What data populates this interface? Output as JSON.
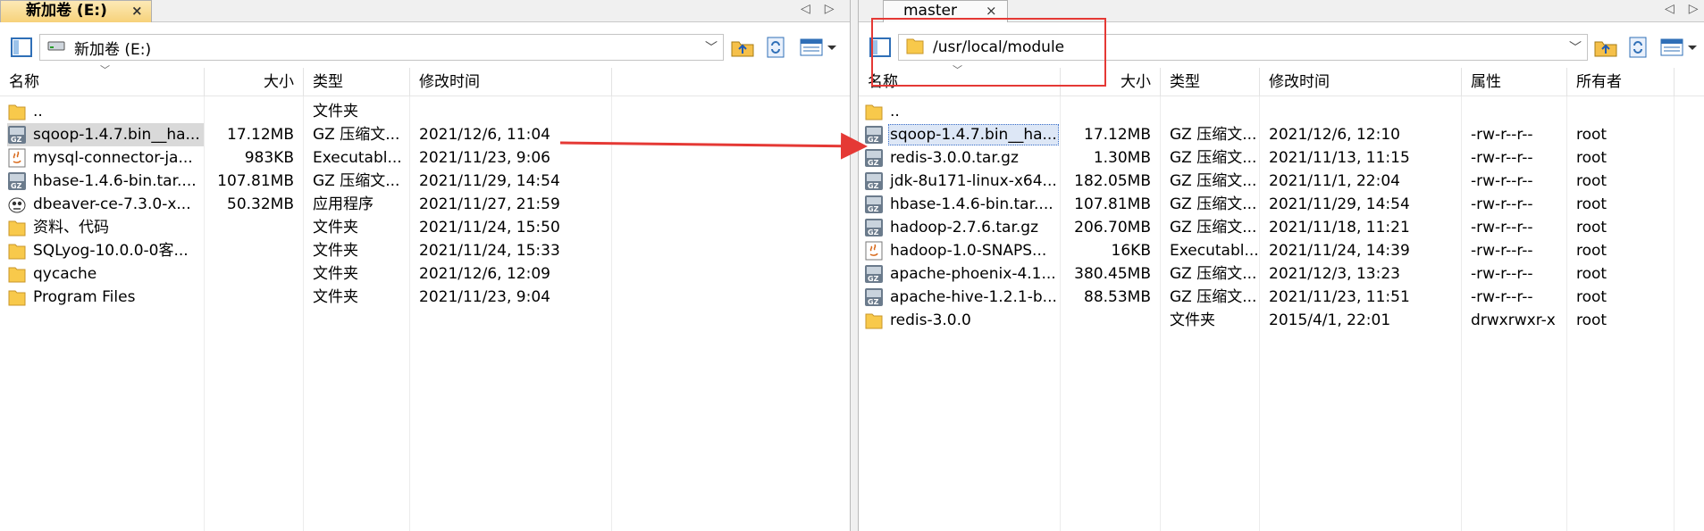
{
  "left_panel": {
    "tab_label": "新加卷 (E:)",
    "tab_close": "×",
    "nav_prev": "◁",
    "nav_next": "▷",
    "drive_combo": {
      "value": "新加卷 (E:)",
      "icon": "drive-icon"
    },
    "columns": {
      "name": "名称",
      "size": "大小",
      "type": "类型",
      "modified": "修改时间"
    },
    "rows": [
      {
        "name": "..",
        "size": "",
        "type": "文件夹",
        "modified": "",
        "icon": "folder-icon"
      },
      {
        "name": "sqoop-1.4.7.bin__ha...",
        "size": "17.12MB",
        "type": "GZ 压缩文...",
        "modified": "2021/12/6, 11:04",
        "icon": "gz-archive-icon"
      },
      {
        "name": "mysql-connector-ja...",
        "size": "983KB",
        "type": "Executabl...",
        "modified": "2021/11/23, 9:06",
        "icon": "java-jar-icon"
      },
      {
        "name": "hbase-1.4.6-bin.tar....",
        "size": "107.81MB",
        "type": "GZ 压缩文...",
        "modified": "2021/11/29, 14:54",
        "icon": "gz-archive-icon"
      },
      {
        "name": "dbeaver-ce-7.3.0-x...",
        "size": "50.32MB",
        "type": "应用程序",
        "modified": "2021/11/27, 21:59",
        "icon": "dbeaver-app-icon"
      },
      {
        "name": "资料、代码",
        "size": "",
        "type": "文件夹",
        "modified": "2021/11/24, 15:50",
        "icon": "folder-icon"
      },
      {
        "name": "SQLyog-10.0.0-0客...",
        "size": "",
        "type": "文件夹",
        "modified": "2021/11/24, 15:33",
        "icon": "folder-icon"
      },
      {
        "name": "qycache",
        "size": "",
        "type": "文件夹",
        "modified": "2021/12/6, 12:09",
        "icon": "folder-icon"
      },
      {
        "name": "Program Files",
        "size": "",
        "type": "文件夹",
        "modified": "2021/11/23, 9:04",
        "icon": "folder-icon"
      }
    ]
  },
  "right_panel": {
    "tab_label": "master",
    "tab_close": "×",
    "nav_prev": "◁",
    "nav_next": "▷",
    "path_combo": {
      "value": "/usr/local/module",
      "icon": "folder-icon"
    },
    "columns": {
      "name": "名称",
      "size": "大小",
      "type": "类型",
      "modified": "修改时间",
      "attributes": "属性",
      "owner": "所有者"
    },
    "rows": [
      {
        "name": "..",
        "size": "",
        "type": "",
        "modified": "",
        "attributes": "",
        "owner": "",
        "icon": "folder-icon"
      },
      {
        "name": "sqoop-1.4.7.bin__ha...",
        "size": "17.12MB",
        "type": "GZ 压缩文...",
        "modified": "2021/12/6, 12:10",
        "attributes": "-rw-r--r--",
        "owner": "root",
        "icon": "gz-archive-icon"
      },
      {
        "name": "redis-3.0.0.tar.gz",
        "size": "1.30MB",
        "type": "GZ 压缩文...",
        "modified": "2021/11/13, 11:15",
        "attributes": "-rw-r--r--",
        "owner": "root",
        "icon": "gz-archive-icon"
      },
      {
        "name": "jdk-8u171-linux-x64...",
        "size": "182.05MB",
        "type": "GZ 压缩文...",
        "modified": "2021/11/1, 22:04",
        "attributes": "-rw-r--r--",
        "owner": "root",
        "icon": "gz-archive-icon"
      },
      {
        "name": "hbase-1.4.6-bin.tar....",
        "size": "107.81MB",
        "type": "GZ 压缩文...",
        "modified": "2021/11/29, 14:54",
        "attributes": "-rw-r--r--",
        "owner": "root",
        "icon": "gz-archive-icon"
      },
      {
        "name": "hadoop-2.7.6.tar.gz",
        "size": "206.70MB",
        "type": "GZ 压缩文...",
        "modified": "2021/11/18, 11:21",
        "attributes": "-rw-r--r--",
        "owner": "root",
        "icon": "gz-archive-icon"
      },
      {
        "name": "hadoop-1.0-SNAPS...",
        "size": "16KB",
        "type": "Executabl...",
        "modified": "2021/11/24, 14:39",
        "attributes": "-rw-r--r--",
        "owner": "root",
        "icon": "java-jar-icon"
      },
      {
        "name": "apache-phoenix-4.1...",
        "size": "380.45MB",
        "type": "GZ 压缩文...",
        "modified": "2021/12/3, 13:23",
        "attributes": "-rw-r--r--",
        "owner": "root",
        "icon": "gz-archive-icon"
      },
      {
        "name": "apache-hive-1.2.1-b...",
        "size": "88.53MB",
        "type": "GZ 压缩文...",
        "modified": "2021/11/23, 11:51",
        "attributes": "-rw-r--r--",
        "owner": "root",
        "icon": "gz-archive-icon"
      },
      {
        "name": "redis-3.0.0",
        "size": "",
        "type": "文件夹",
        "modified": "2015/4/1, 22:01",
        "attributes": "drwxrwxr-x",
        "owner": "root",
        "icon": "folder-icon"
      }
    ]
  },
  "annotations": {
    "highlight_color": "#e53935",
    "arrow_color": "#e53935"
  },
  "colors": {
    "folder": "#f8c94b",
    "tab_active": "#f7d27a",
    "selection": "#d9d9d9"
  }
}
